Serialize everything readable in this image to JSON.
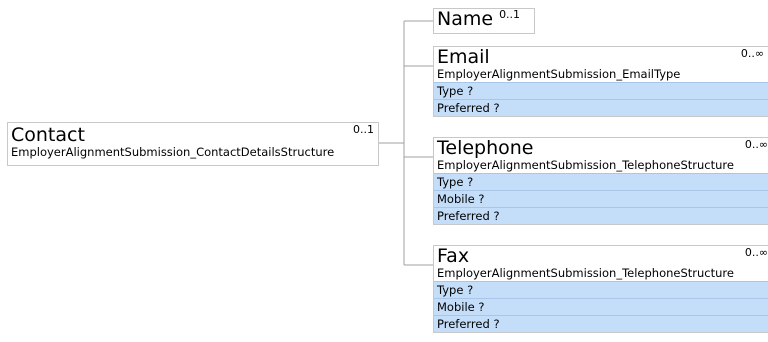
{
  "colors": {
    "box_border": "#c8c8c8",
    "attribute_fill": "#c4defa",
    "connector": "#a0a0a0"
  },
  "contact": {
    "title": "Contact",
    "cardinality": "0..1",
    "type": "EmployerAlignmentSubmission_ContactDetailsStructure"
  },
  "name": {
    "title": "Name",
    "cardinality": "0..1"
  },
  "email": {
    "title": "Email",
    "cardinality": "0..∞",
    "type": "EmployerAlignmentSubmission_EmailType",
    "attributes": [
      "Type ?",
      "Preferred ?"
    ]
  },
  "telephone": {
    "title": "Telephone",
    "cardinality": "0..∞",
    "type": "EmployerAlignmentSubmission_TelephoneStructure",
    "attributes": [
      "Type ?",
      "Mobile ?",
      "Preferred ?"
    ]
  },
  "fax": {
    "title": "Fax",
    "cardinality": "0..∞",
    "type": "EmployerAlignmentSubmission_TelephoneStructure",
    "attributes": [
      "Type ?",
      "Mobile ?",
      "Preferred ?"
    ]
  }
}
